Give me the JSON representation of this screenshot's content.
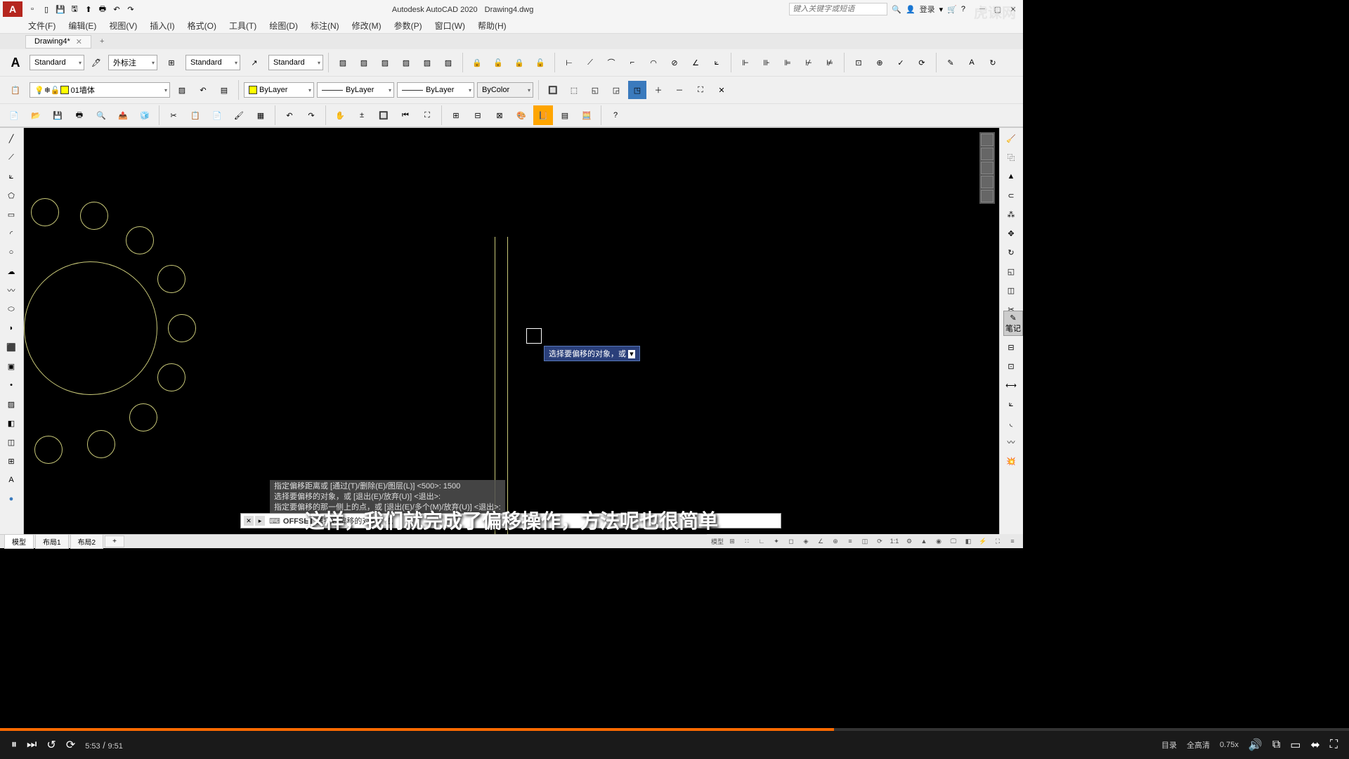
{
  "app": {
    "name": "Autodesk AutoCAD 2020",
    "document": "Drawing4.dwg",
    "logo_letter": "A"
  },
  "search": {
    "placeholder": "键入关键字或短语"
  },
  "login": {
    "label": "登录"
  },
  "menus": [
    "文件(F)",
    "编辑(E)",
    "视图(V)",
    "插入(I)",
    "格式(O)",
    "工具(T)",
    "绘图(D)",
    "标注(N)",
    "修改(M)",
    "参数(P)",
    "窗口(W)",
    "帮助(H)"
  ],
  "doc_tab": {
    "name": "Drawing4*",
    "add": "+"
  },
  "ribbon": {
    "style1": "Standard",
    "style2": "外标注",
    "style3": "Standard",
    "style4": "Standard",
    "layer_name": "01墙体",
    "bylayer1": "ByLayer",
    "bylayer2": "ByLayer",
    "bylayer3": "ByLayer",
    "bycolor": "ByColor"
  },
  "tooltip": {
    "text": "选择要偏移的对象，或"
  },
  "command_history": [
    "指定偏移距离或 [通过(T)/删除(E)/图层(L)] <500>:  1500",
    "选择要偏移的对象，或 [退出(E)/放弃(U)] <退出>:",
    "指定要偏移的那一侧上的点，或 [退出(E)/多个(M)/放弃(U)] <退出>:"
  ],
  "command_line": {
    "cmd": "OFFSET",
    "prompt": "选择要偏移的对象，或"
  },
  "bottom_tabs": {
    "model": "模型",
    "layout1": "布局1",
    "layout2": "布局2",
    "add": "+"
  },
  "status": {
    "model_label": "模型",
    "scale": "1:1"
  },
  "subtitle": "这样，我们就完成了偏移操作，方法呢也很简单",
  "notes_label": "笔记",
  "video": {
    "current": "5:53",
    "total": "9:51",
    "toc": "目录",
    "quality": "全高清",
    "speed": "0.75x"
  },
  "watermark": "虎课网"
}
